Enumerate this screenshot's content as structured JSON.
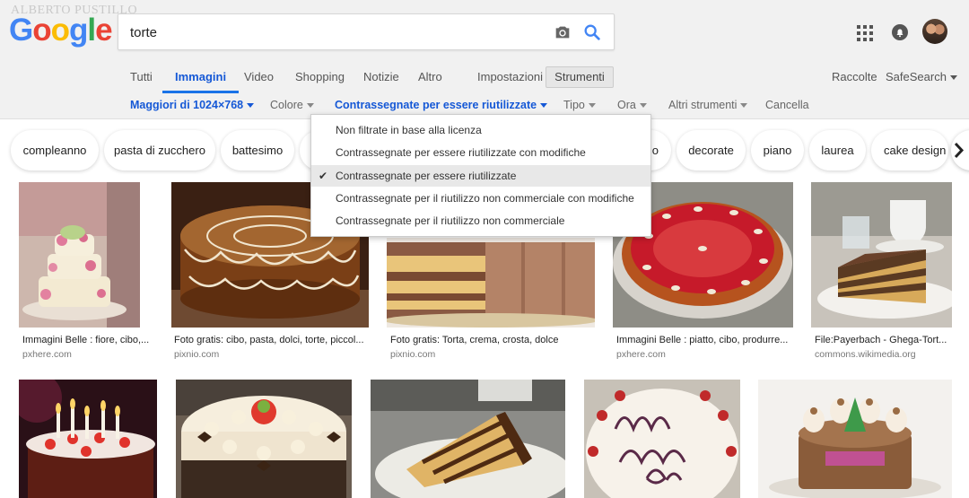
{
  "watermark": "ALBERTO PUSTILLO",
  "logo": [
    "G",
    "o",
    "o",
    "g",
    "l",
    "e"
  ],
  "search": {
    "query": "torte",
    "camera_icon": "camera-icon",
    "search_icon": "magnifier-icon"
  },
  "header_icons": {
    "apps": "apps-grid-icon",
    "notifications": "bell-icon",
    "avatar": "user-avatar"
  },
  "tabs": [
    "Tutti",
    "Immagini",
    "Video",
    "Shopping",
    "Notizie",
    "Altro",
    "Impostazioni",
    "Strumenti"
  ],
  "right_links": {
    "collections": "Raccolte",
    "safesearch": "SafeSearch"
  },
  "tools": {
    "size": "Maggiori di 1024×768",
    "color": "Colore",
    "license": "Contrassegnate per essere riutilizzate",
    "type": "Tipo",
    "time": "Ora",
    "more": "Altri strumenti",
    "clear": "Cancella"
  },
  "chips": [
    "compleanno",
    "pasta di zucchero",
    "battesimo",
    "o",
    "decorate",
    "piano",
    "laurea",
    "cake design"
  ],
  "license_menu": {
    "items": [
      "Non filtrate in base alla licenza",
      "Contrassegnate per essere riutilizzate con modifiche",
      "Contrassegnate per essere riutilizzate",
      "Contrassegnate per il riutilizzo non commerciale con modifiche",
      "Contrassegnate per il riutilizzo non commerciale"
    ],
    "selected_index": 2,
    "check": "✔"
  },
  "results_row1": [
    {
      "caption": "Immagini Belle : fiore, cibo,...",
      "source": "pxhere.com"
    },
    {
      "caption": "Foto gratis: cibo, pasta, dolci, torte, piccol...",
      "source": "pixnio.com"
    },
    {
      "caption": "Foto gratis: Torta, crema, crosta, dolce",
      "source": "pixnio.com"
    },
    {
      "caption": "Immagini Belle : piatto, cibo, produrre...",
      "source": "pxhere.com"
    },
    {
      "caption": "File:Payerbach - Ghega-Tort...",
      "source": "commons.wikimedia.org"
    }
  ],
  "colors": {
    "accent": "#1a73e8",
    "header_bg": "#f1f1f1"
  }
}
